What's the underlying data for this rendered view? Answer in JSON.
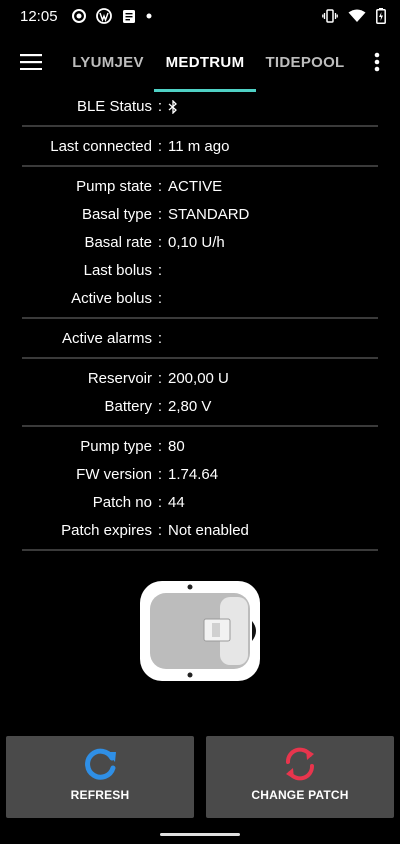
{
  "status_bar": {
    "time": "12:05"
  },
  "tabs": [
    {
      "label": "LYUMJEV"
    },
    {
      "label": "MEDTRUM"
    },
    {
      "label": "TIDEPOOL"
    }
  ],
  "separator": ":",
  "groups": [
    [
      {
        "label": "BLE Status",
        "value": ""
      }
    ],
    [
      {
        "label": "Last connected",
        "value": "11 m ago"
      }
    ],
    [
      {
        "label": "Pump state",
        "value": "ACTIVE"
      },
      {
        "label": "Basal type",
        "value": "STANDARD"
      },
      {
        "label": "Basal rate",
        "value": "0,10 U/h"
      },
      {
        "label": "Last bolus",
        "value": ""
      },
      {
        "label": "Active bolus",
        "value": ""
      }
    ],
    [
      {
        "label": "Active alarms",
        "value": ""
      }
    ],
    [
      {
        "label": "Reservoir",
        "value": "200,00 U"
      },
      {
        "label": "Battery",
        "value": "2,80 V"
      }
    ],
    [
      {
        "label": "Pump type",
        "value": "80"
      },
      {
        "label": "FW version",
        "value": "1.74.64"
      },
      {
        "label": "Patch no",
        "value": "44"
      },
      {
        "label": "Patch expires",
        "value": "Not enabled"
      }
    ]
  ],
  "buttons": {
    "refresh": {
      "label": "REFRESH",
      "icon": "refresh-icon",
      "color": "#2f8fe6"
    },
    "change_patch": {
      "label": "CHANGE PATCH",
      "icon": "change-patch-icon",
      "color": "#e8354d"
    }
  },
  "colors": {
    "accent": "#4fd1c5",
    "background": "#000000",
    "button_bg": "#4a4a4a"
  }
}
